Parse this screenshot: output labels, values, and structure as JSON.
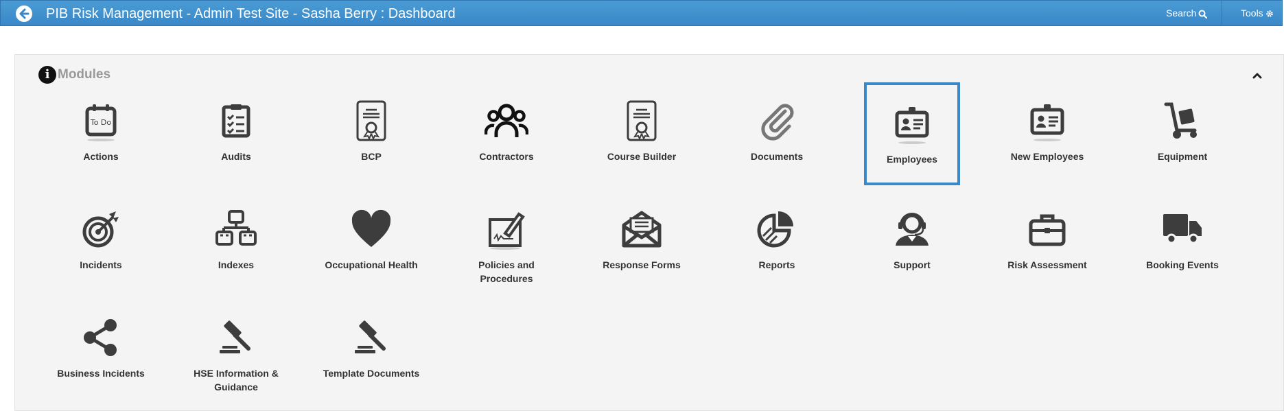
{
  "header": {
    "title": "PIB Risk Management - Admin Test Site - Sasha Berry : Dashboard",
    "search_label": "Search",
    "tools_label": "Tools"
  },
  "panel": {
    "title": "Modules"
  },
  "modules": [
    {
      "label": "Actions",
      "icon": "todo-calendar-icon"
    },
    {
      "label": "Audits",
      "icon": "clipboard-checklist-icon"
    },
    {
      "label": "BCP",
      "icon": "certificate-icon"
    },
    {
      "label": "Contractors",
      "icon": "people-group-icon"
    },
    {
      "label": "Course Builder",
      "icon": "certificate-icon"
    },
    {
      "label": "Documents",
      "icon": "paperclip-icon"
    },
    {
      "label": "Employees",
      "icon": "id-badge-icon"
    },
    {
      "label": "New Employees",
      "icon": "id-badge-icon"
    },
    {
      "label": "Equipment",
      "icon": "hand-truck-icon"
    },
    {
      "label": "Incidents",
      "icon": "target-icon"
    },
    {
      "label": "Indexes",
      "icon": "sitemap-icon"
    },
    {
      "label": "Occupational Health",
      "icon": "heart-icon"
    },
    {
      "label": "Policies and Procedures",
      "icon": "signature-pen-icon"
    },
    {
      "label": "Response Forms",
      "icon": "envelope-open-icon"
    },
    {
      "label": "Reports",
      "icon": "pie-chart-icon"
    },
    {
      "label": "Support",
      "icon": "headset-agent-icon"
    },
    {
      "label": "Risk Assessment",
      "icon": "briefcase-icon"
    },
    {
      "label": "Booking Events",
      "icon": "truck-icon"
    },
    {
      "label": "Business Incidents",
      "icon": "share-icon"
    },
    {
      "label": "HSE Information & Guidance",
      "icon": "gavel-icon"
    },
    {
      "label": "Template Documents",
      "icon": "gavel-icon"
    }
  ],
  "selected_module": "Employees",
  "colors": {
    "header_blue": "#3a88c8",
    "icon_dark": "#3d3d3d",
    "selected_border": "#3a88c8"
  }
}
